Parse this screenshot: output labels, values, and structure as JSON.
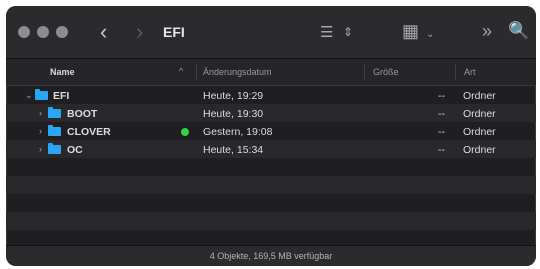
{
  "toolbar": {
    "title": "EFI",
    "back_glyph": "‹",
    "forward_glyph": "›",
    "list_glyph": "☰",
    "updown_glyph": "⇕",
    "grid_glyph": "▦",
    "griddown_glyph": "⌄",
    "more_glyph": "»",
    "search_glyph": "🔍"
  },
  "header": {
    "name": "Name",
    "sort_glyph": "^",
    "date": "Änderungsdatum",
    "size": "Größe",
    "kind": "Art"
  },
  "rows": [
    {
      "disclosure": "⌄",
      "name": "EFI",
      "date": "Heute, 19:29",
      "size": "--",
      "kind": "Ordner"
    },
    {
      "disclosure": "›",
      "name": "BOOT",
      "date": "Heute, 19:30",
      "size": "--",
      "kind": "Ordner"
    },
    {
      "disclosure": "›",
      "name": "CLOVER",
      "date": "Gestern, 19:08",
      "size": "--",
      "kind": "Ordner",
      "tag_color": "#2fd44a"
    },
    {
      "disclosure": "›",
      "name": "OC",
      "date": "Heute, 15:34",
      "size": "--",
      "kind": "Ordner"
    }
  ],
  "footer": {
    "status": "4 Objekte, 169,5 MB verfügbar"
  },
  "colors": {
    "folder": "#2aa6f5",
    "green_tag": "#2fd44a",
    "window_bg": "#1f1f21"
  }
}
